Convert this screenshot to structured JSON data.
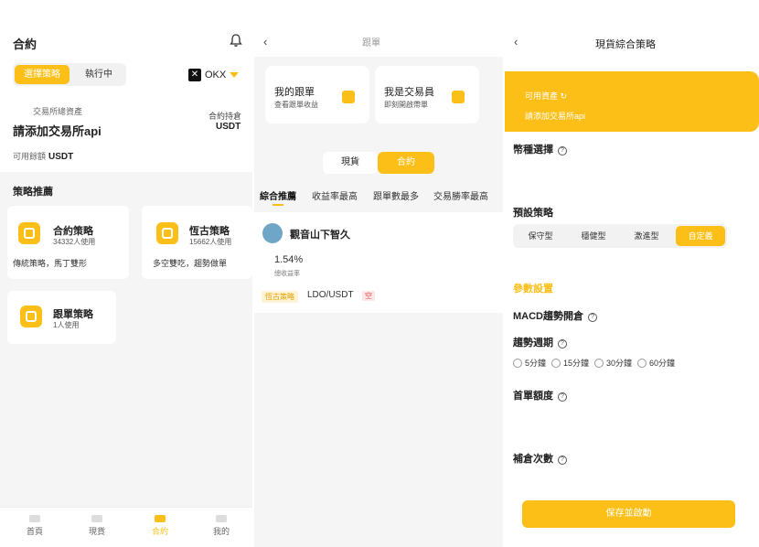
{
  "panel1": {
    "title": "合約",
    "tabs": [
      "選擇策略",
      "執行中"
    ],
    "exchange": "OKX",
    "assets_label": "交易所總資產",
    "assets_link": "請添加交易所api",
    "hold_label": "合約持倉",
    "hold_value": "USDT",
    "avail_label": "可用餘額",
    "avail_unit": "USDT",
    "section_title": "策略推薦",
    "cards": [
      {
        "name": "合約策略",
        "users": "34332人使用",
        "desc": "傳統策略，馬丁雙形"
      },
      {
        "name": "恆古策略",
        "users": "15662人使用",
        "desc": "多空雙吃，趨勢做單"
      },
      {
        "name": "跟單策略",
        "users": "1人使用",
        "desc": ""
      }
    ],
    "nav": [
      "首頁",
      "現貨",
      "合約",
      "我的"
    ]
  },
  "panel2": {
    "title": "跟單",
    "card_left": {
      "title": "我的跟單",
      "sub": "查看跟單收益"
    },
    "card_right": {
      "title": "我是交易員",
      "sub": "即刻開啟帶單"
    },
    "segments": [
      "現貨",
      "合約"
    ],
    "sort_tabs": [
      "綜合推薦",
      "收益率最高",
      "跟單數最多",
      "交易勝率最高"
    ],
    "trader": {
      "name": "觀音山下智久",
      "pct": "1.54%",
      "pct_label": "總收益率",
      "tag": "恆古策略",
      "pair": "LDO/USDT",
      "side": "空"
    }
  },
  "panel3": {
    "title": "現貨綜合策略",
    "banner_available": "可用資產",
    "banner_link": "請添加交易所api",
    "coin_select": "幣種選擇",
    "preset_title": "預設策略",
    "presets": [
      "保守型",
      "穩健型",
      "激進型",
      "自定義"
    ],
    "param_title": "參數設置",
    "macd": "MACD趨勢開倉",
    "trend_period": "趨勢週期",
    "periods": [
      "5分鐘",
      "15分鐘",
      "30分鐘",
      "60分鐘"
    ],
    "first_amount": "首單額度",
    "add_times": "補倉次數",
    "save_label": "保存並啟動"
  },
  "colors": {
    "accent": "#fcbf17",
    "background": "#f5f5f5"
  },
  "icons": [
    "bell-icon",
    "okx-logo-icon",
    "dropdown-triangle-icon",
    "back-chevron-icon",
    "help-circle-icon",
    "refresh-icon"
  ]
}
